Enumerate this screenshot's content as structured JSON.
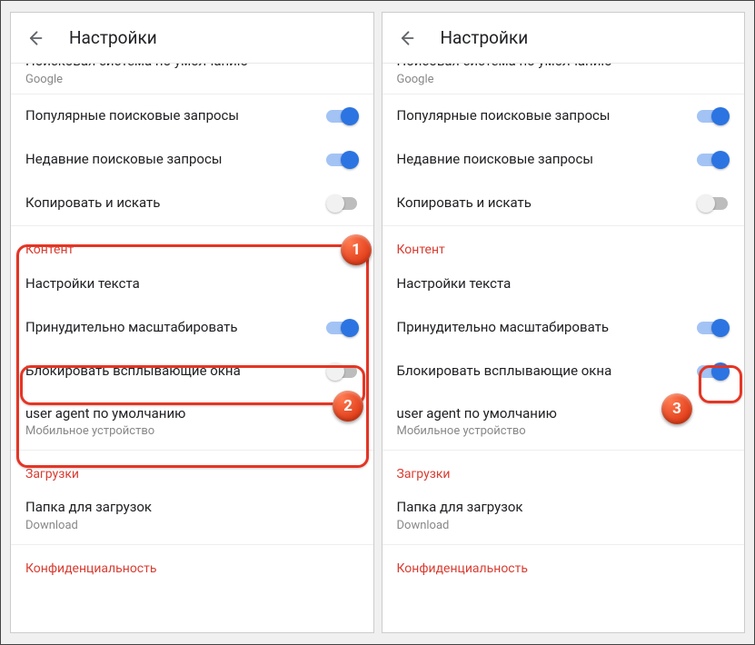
{
  "screens": {
    "left": {
      "header": {
        "title": "Настройки"
      },
      "default_search": {
        "title": "Поисковая система по умолчанию",
        "sub": "Google"
      },
      "popular_queries": {
        "title": "Популярные поисковые запросы",
        "on": true
      },
      "recent_queries": {
        "title": "Недавние поисковые запросы",
        "on": true
      },
      "copy_search": {
        "title": "Копировать и искать",
        "on": false
      },
      "content_header": "Контент",
      "text_settings": {
        "title": "Настройки текста"
      },
      "force_zoom": {
        "title": "Принудительно масштабировать",
        "on": true
      },
      "block_popups": {
        "title": "Блокировать всплывающие окна",
        "on": false
      },
      "user_agent": {
        "title": "user agent по умолчанию",
        "sub": "Мобильное устройство"
      },
      "downloads_header": "Загрузки",
      "download_folder": {
        "title": "Папка для загрузок",
        "sub": "Download"
      },
      "privacy_header": "Конфиденциальность"
    },
    "right": {
      "header": {
        "title": "Настройки"
      },
      "default_search": {
        "title": "Поисовая система по умолчанию",
        "sub": "Google"
      },
      "popular_queries": {
        "title": "Популярные поисковые запросы",
        "on": true
      },
      "recent_queries": {
        "title": "Недавние поисковые запросы",
        "on": true
      },
      "copy_search": {
        "title": "Копировать и искать",
        "on": false
      },
      "content_header": "Контент",
      "text_settings": {
        "title": "Настройки текста"
      },
      "force_zoom": {
        "title": "Принудительно масштабировать",
        "on": true
      },
      "block_popups": {
        "title": "Блокировать всплывающие окна",
        "on": true
      },
      "user_agent": {
        "title": "user agent по умолчанию",
        "sub": "Мобильное устройство"
      },
      "downloads_header": "Загрузки",
      "download_folder": {
        "title": "Папка для загрузок",
        "sub": "Download"
      },
      "privacy_header": "Конфиденциальность"
    }
  },
  "annotations": {
    "badge1": "1",
    "badge2": "2",
    "badge3": "3"
  }
}
